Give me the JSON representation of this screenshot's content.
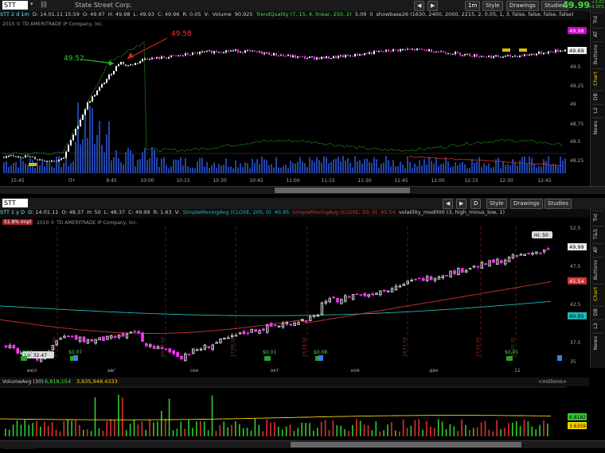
{
  "top_chart": {
    "symbol": "STT",
    "company": "State Street Corp.",
    "timeframe_btn": "1m",
    "buttons": {
      "style": "Style",
      "drawings": "Drawings",
      "studies": "Studies"
    },
    "last_price": "49.99",
    "change_up": "+1.62",
    "change_pct": "+3.35%",
    "status": [
      "STT 2 d 1m",
      "D: 14.01.11 15:59",
      "O: 49.97",
      "H: 49.98",
      "L: 49.93",
      "C: 49.96",
      "R: 0.05",
      "V:",
      "Volume",
      "90,925",
      "TrendQuality (7, 15, 4, linear, 250, 2)",
      "5.09",
      "0",
      "showbase26 (1630, 2400, 2000, 2215, 2, 0.05, 1, 3, false, false, false, false)"
    ],
    "copyright": "2010 © TD AMERITRADE IP Company, Inc.",
    "annotations": {
      "left": "49.52",
      "right": "49.58"
    },
    "price_labels": [
      "49.98",
      "49.69",
      "49.5",
      "49.25",
      "49",
      "48.75",
      "48.5",
      "48.25"
    ],
    "time_labels": [
      "15:45",
      "Пт",
      "9:45",
      "10:00",
      "10:15",
      "10:30",
      "10:45",
      "11:00",
      "11:15",
      "11:30",
      "11:45",
      "12:00",
      "12:15",
      "12:30",
      "12:45"
    ],
    "side_tabs": [
      "Trd",
      "AT",
      "Buttons",
      "Chart",
      "DB",
      "L2",
      "News"
    ],
    "active_tab": "Chart"
  },
  "bottom_chart": {
    "symbol": "STT",
    "timeframe_btn": "D",
    "buttons": {
      "style": "Style",
      "drawings": "Drawings",
      "studies": "Studies"
    },
    "status": [
      "STT 1 y D",
      "D: 14.01.11",
      "O: 48.37",
      "H: 50",
      "L: 48.37",
      "C: 49.99",
      "R: 1.63",
      "V:",
      "SimpleMovingAvg (CLOSE, 200, 0)",
      "40.95",
      "SimpleMovingAvg (CLOSE, 50, 0)",
      "45.54",
      "volatility_mod000 (3, high_minus_low, 1)"
    ],
    "badge": "51.8% Impl",
    "copyright": "2010 © TD AMERITRADE IP Company, Inc.",
    "hi_label": "Hi: 50",
    "lo_label": "Lo: 32.47",
    "price_labels": [
      "52.5",
      "50",
      "47.5",
      "45",
      "42.5",
      "40",
      "37.5",
      "35",
      "32.5"
    ],
    "current_labels": {
      "last": "49.99",
      "sma50": "45.54",
      "sma200": "40.95"
    },
    "month_labels": [
      "июл",
      "авг",
      "сен",
      "окт",
      "ноя",
      "дек",
      "11"
    ],
    "dividends": [
      "$0.01",
      "$0.07",
      "$0.01",
      "$0.08",
      "$0.01"
    ],
    "date_labels": [
      "17.07.10",
      "20.08.10",
      "17.09.10",
      "15.10.10",
      "19.11.10",
      "17.12.10",
      "21.01.11"
    ],
    "side_tabs": [
      "Trd",
      "T&S",
      "AT",
      "Buttons",
      "Chart",
      "DB",
      "L2",
      "News"
    ],
    "active_tab": "Chart"
  },
  "volume_pane": {
    "title": "VolumeAvg (30)",
    "value1": "6,818,154",
    "value2": "3,635,948.4333",
    "unit": "<millions>",
    "labels": {
      "v1": "6.8182",
      "v2": "3.6359"
    }
  },
  "colors": {
    "up": "#ffffff",
    "down": "#ff33ff",
    "price_green": "#3fe03f",
    "sma50": "#d23030",
    "sma200": "#1fb8b8",
    "volume_up": "#2ecc2e",
    "volume_down": "#e03030"
  }
}
